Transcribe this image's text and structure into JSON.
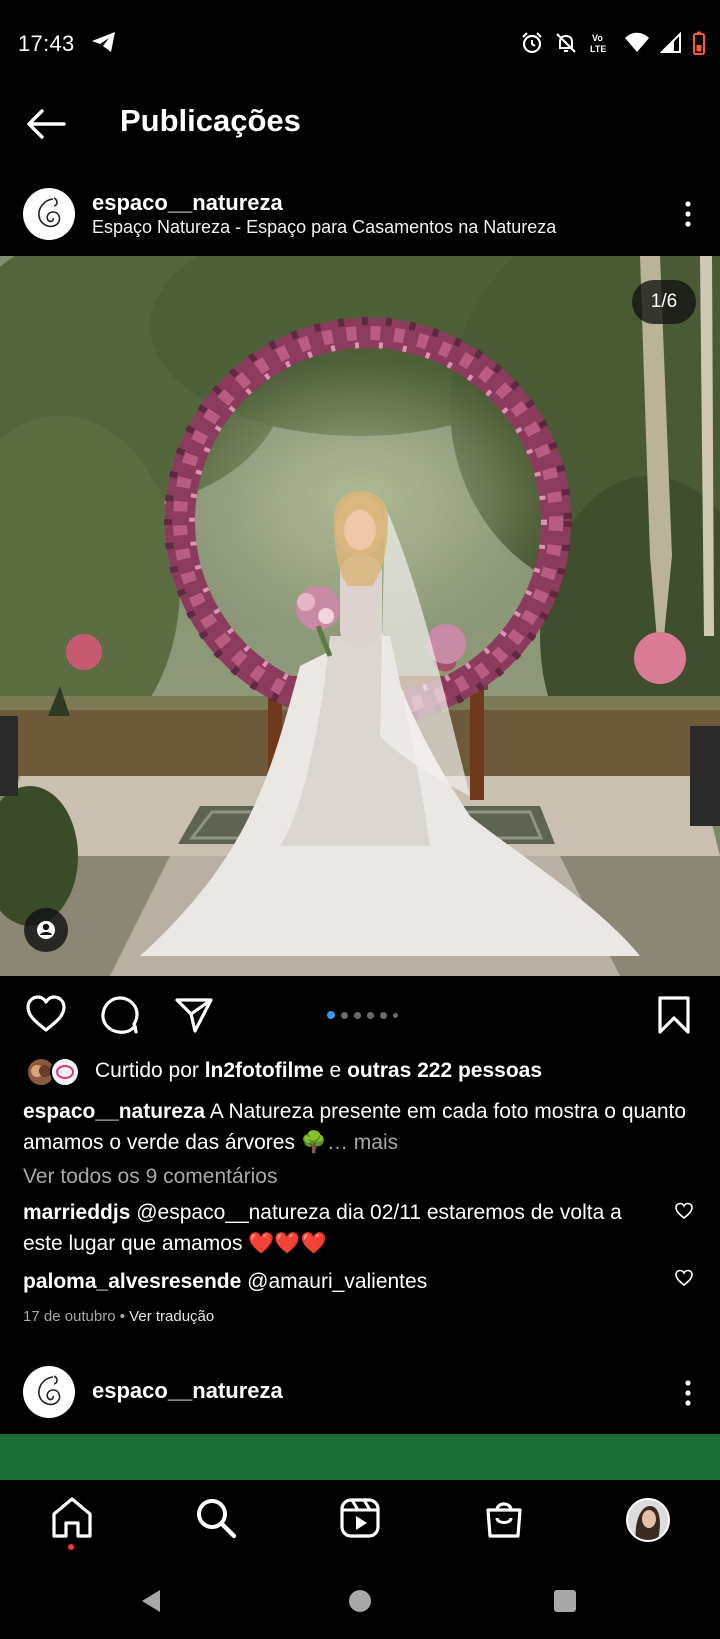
{
  "status_bar": {
    "time": "17:43",
    "icons": [
      "telegram-icon",
      "alarm-icon",
      "notifications-off-icon",
      "volte-icon",
      "wifi-icon",
      "signal-icon",
      "battery-low-icon"
    ],
    "volte_label": "Vo\nLTE",
    "battery_color": "#ff5a3c"
  },
  "header": {
    "title": "Publicações",
    "back_icon": "arrow-left-icon"
  },
  "post": {
    "username": "espaco__natureza",
    "location": "Espaço Natureza - Espaço para Casamentos na Natureza",
    "photo_counter": "1/6",
    "carousel": {
      "count": 6,
      "active_index": 0
    },
    "likes": {
      "prefix": "Curtido por ",
      "user": "ln2fotofilme",
      "middle": " e ",
      "others": "outras 222 pessoas"
    },
    "caption": {
      "username": "espaco__natureza",
      "text": " A Natureza presente em cada foto mostra o quanto amamos o verde das árvores 🌳",
      "more": "… mais"
    },
    "view_comments": "Ver todos os 9 comentários",
    "comments": [
      {
        "username": "marrieddjs",
        "text": " @espaco__natureza dia 02/11 estaremos de volta a este lugar que amamos ❤️❤️❤️"
      },
      {
        "username": "paloma_alvesresende",
        "text": " @amauri_valientes"
      }
    ],
    "date": "17 de outubro",
    "separator": " • ",
    "translate": "Ver tradução"
  },
  "next_post": {
    "username": "espaco__natureza",
    "strip_color": "#1a6f36"
  },
  "bottom_nav": {
    "items": [
      "home-icon",
      "search-icon",
      "reels-icon",
      "shop-icon",
      "profile-avatar"
    ],
    "active": "home-icon",
    "badge_color": "#ff3040"
  },
  "colors": {
    "background": "#000000",
    "muted_text": "#a8a8a8",
    "accent_blue": "#3797f0"
  }
}
